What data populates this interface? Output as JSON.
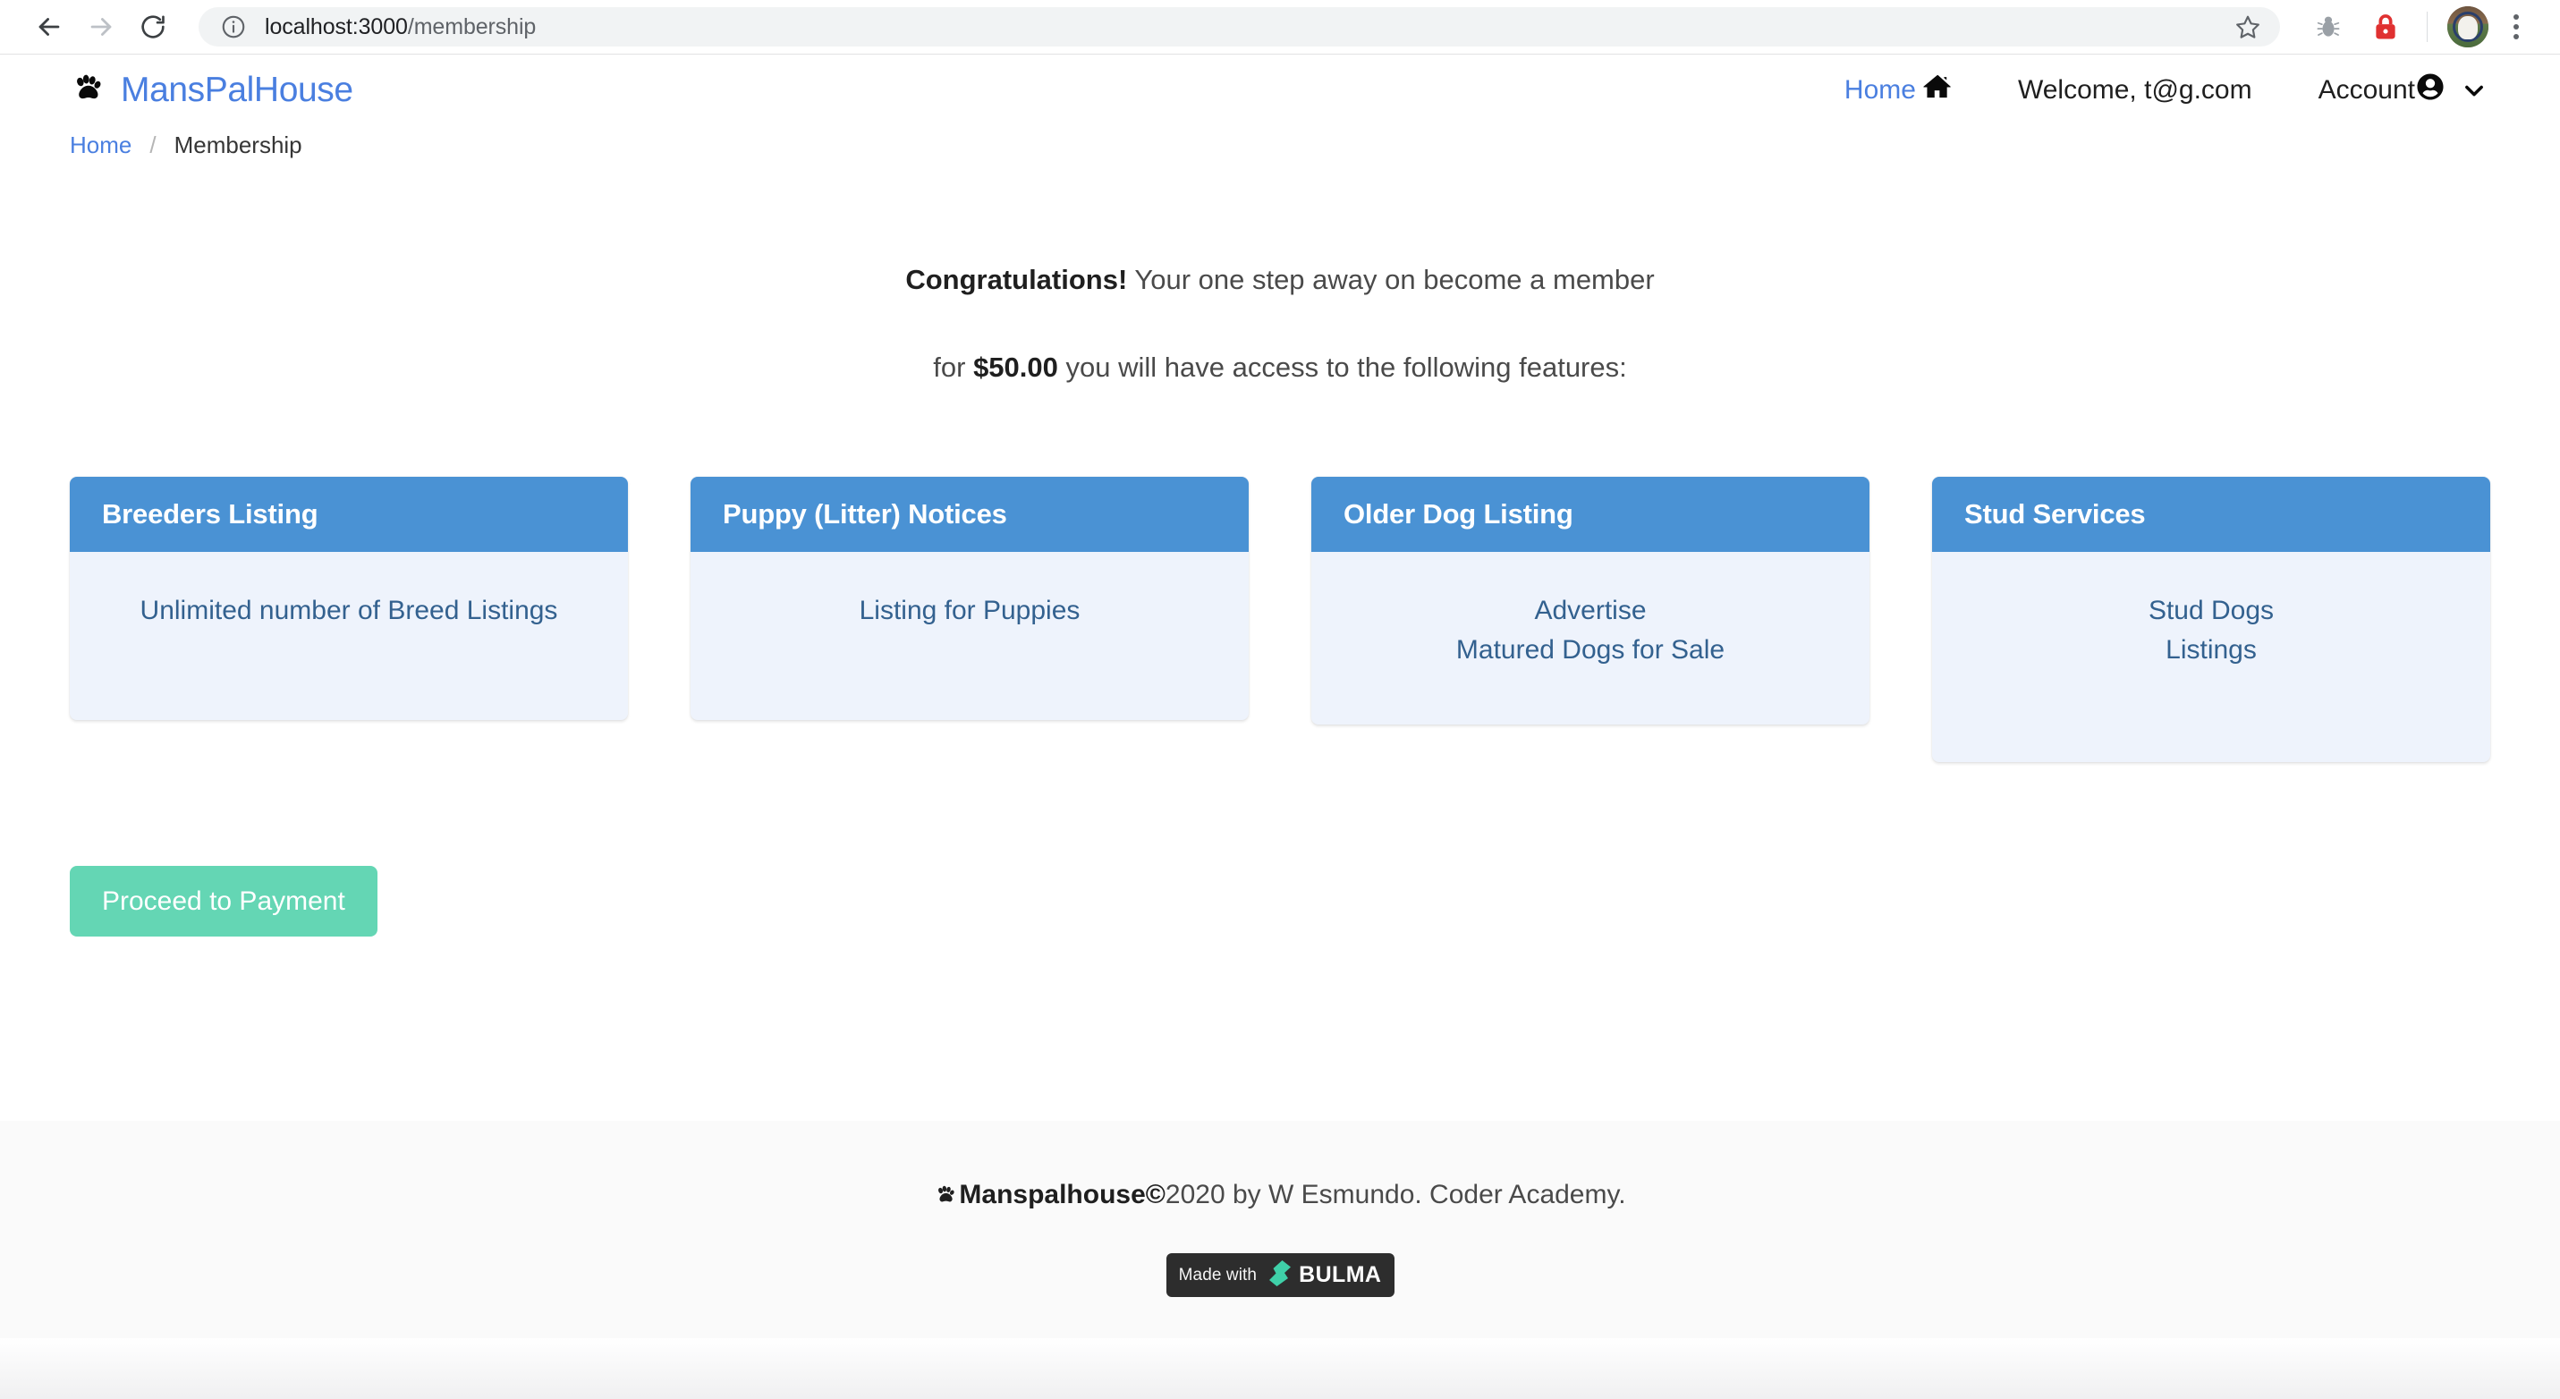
{
  "browser": {
    "back_label": "Back",
    "forward_label": "Forward",
    "reload_label": "Reload",
    "site_info_label": "View site information",
    "url_host": "localhost:3000",
    "url_path": "/membership",
    "bookmark_label": "Bookmark this tab",
    "extensions": [
      {
        "name": "bug-extension",
        "label": "Bug extension"
      },
      {
        "name": "lock-extension",
        "label": "Lock extension",
        "color": "#e03131"
      }
    ],
    "profile_label": "Profile",
    "menu_label": "Customize and control Google Chrome"
  },
  "navbar": {
    "brand": "MansPalHouse",
    "brand_color": "#4a7fe0",
    "logo_icon": "paw-icon",
    "home_label": "Home",
    "home_icon": "house-icon",
    "welcome_label": "Welcome, t@g.com",
    "account_label": "Account",
    "account_icon": "user-circle-icon",
    "account_chevron": "chevron-down-icon"
  },
  "breadcrumb": {
    "home": "Home",
    "separator": "/",
    "current": "Membership"
  },
  "main": {
    "headline_bold": "Congratulations!",
    "headline_rest": "Your one step away on become a member",
    "price_prefix": "for",
    "price": "$50.00",
    "price_suffix": "you will have access to the following features:",
    "cards": [
      {
        "title": "Breeders Listing",
        "body": "Unlimited number of Breed Listings",
        "tall": false
      },
      {
        "title": "Puppy (Litter) Notices",
        "body": "Listing for Puppies",
        "tall": false
      },
      {
        "title": "Older Dog Listing",
        "body": "Advertise\nMatured Dogs for Sale",
        "tall": false
      },
      {
        "title": "Stud Services",
        "body": "Stud Dogs\nListings",
        "tall": true
      }
    ],
    "card_header_color": "#4a92d4",
    "card_body_color": "#eef3fc",
    "card_text_color": "#33618f",
    "proceed_label": "Proceed to Payment",
    "proceed_color": "#64d6b4"
  },
  "footer": {
    "logo_icon": "paw-icon",
    "brand_bold": "Manspalhouse©",
    "credit": " 2020 by W Esmundo. Coder Academy.",
    "badge_made_with": "Made with",
    "badge_brand": "BULMA",
    "badge_bg": "#2d2d2d",
    "badge_accent": "#3fd0a8"
  }
}
